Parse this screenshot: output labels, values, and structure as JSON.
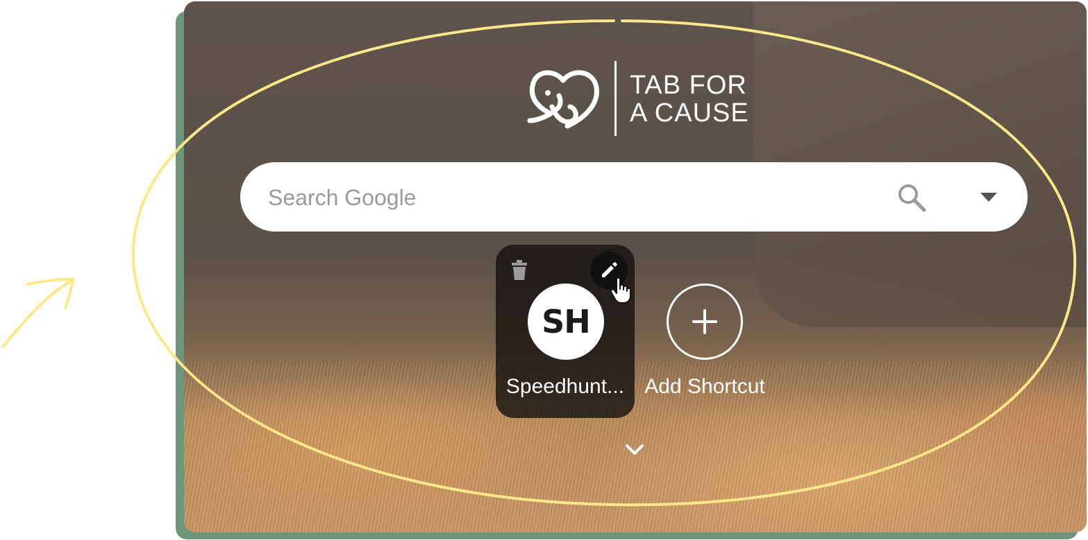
{
  "logo": {
    "line1": "TAB FOR",
    "line2": "A CAUSE"
  },
  "search": {
    "placeholder": "Search Google",
    "icon": "search-icon",
    "dropdown_icon": "caret-down-icon"
  },
  "shortcuts": [
    {
      "initials": "SH",
      "label": "Speedhunt...",
      "delete_icon": "trash-icon",
      "edit_icon": "pencil-icon"
    }
  ],
  "add_shortcut": {
    "label": "Add Shortcut",
    "icon": "plus-icon"
  },
  "expand_icon": "chevron-down-icon",
  "colors": {
    "frame_shadow": "#6f9479",
    "annotation": "#fce78a",
    "card": "#141210"
  }
}
